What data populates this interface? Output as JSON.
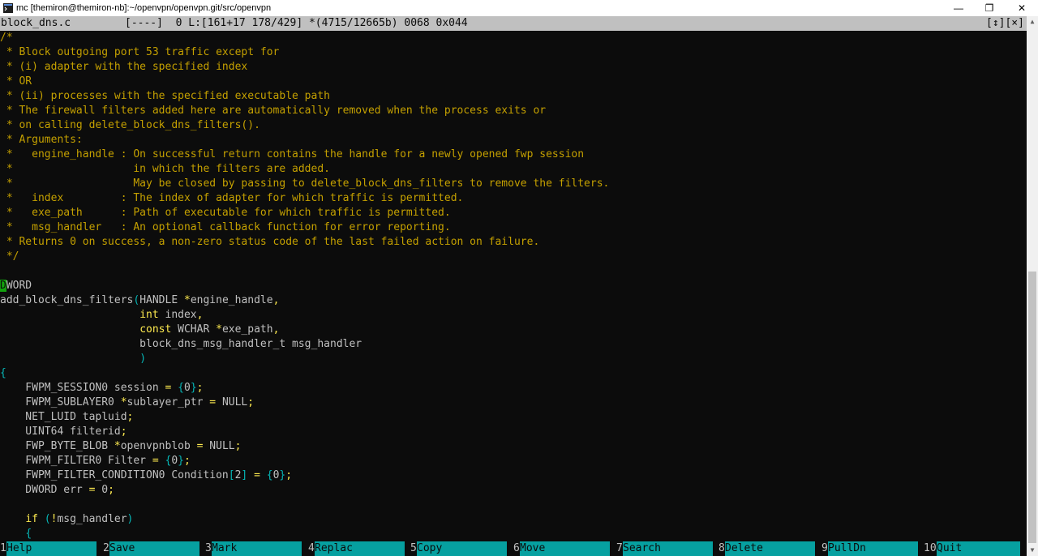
{
  "window": {
    "title": "mc [themiron@themiron-nb]:~/openvpn/openvpn.git/src/openvpn",
    "minimize": "—",
    "maximize": "❐",
    "close": "✕"
  },
  "status": {
    "filename": "block_dns.c",
    "info": "[----]  0 L:[161+17 178/429] *(4715/12665b) 0068 0x044",
    "controls": "[↕][×]"
  },
  "code": [
    [
      [
        "cm",
        "/*"
      ]
    ],
    [
      [
        "cm",
        " * Block outgoing port 53 traffic except for"
      ]
    ],
    [
      [
        "cm",
        " * (i) adapter with the specified index"
      ]
    ],
    [
      [
        "cm",
        " * OR"
      ]
    ],
    [
      [
        "cm",
        " * (ii) processes with the specified executable path"
      ]
    ],
    [
      [
        "cm",
        " * The firewall filters added here are automatically removed when the process exits or"
      ]
    ],
    [
      [
        "cm",
        " * on calling delete_block_dns_filters()."
      ]
    ],
    [
      [
        "cm",
        " * Arguments:"
      ]
    ],
    [
      [
        "cm",
        " *   engine_handle : On successful return contains the handle for a newly opened fwp session"
      ]
    ],
    [
      [
        "cm",
        " *                   in which the filters are added."
      ]
    ],
    [
      [
        "cm",
        " *                   May be closed by passing to delete_block_dns_filters to remove the filters."
      ]
    ],
    [
      [
        "cm",
        " *   index         : The index of adapter for which traffic is permitted."
      ]
    ],
    [
      [
        "cm",
        " *   exe_path      : Path of executable for which traffic is permitted."
      ]
    ],
    [
      [
        "cm",
        " *   msg_handler   : An optional callback function for error reporting."
      ]
    ],
    [
      [
        "cm",
        " * Returns 0 on success, a non-zero status code of the last failed action on failure."
      ]
    ],
    [
      [
        "cm",
        " */"
      ]
    ],
    [],
    [
      [
        "cursor",
        "D"
      ],
      [
        "tx",
        "WORD"
      ]
    ],
    [
      [
        "tx",
        "add_block_dns_filters"
      ],
      [
        "br",
        "("
      ],
      [
        "tx",
        "HANDLE "
      ],
      [
        "kw",
        "*"
      ],
      [
        "tx",
        "engine_handle"
      ],
      [
        "kw",
        ","
      ]
    ],
    [
      [
        "tx",
        "                      "
      ],
      [
        "kw",
        "int"
      ],
      [
        "tx",
        " index"
      ],
      [
        "kw",
        ","
      ]
    ],
    [
      [
        "tx",
        "                      "
      ],
      [
        "kw",
        "const"
      ],
      [
        "tx",
        " WCHAR "
      ],
      [
        "kw",
        "*"
      ],
      [
        "tx",
        "exe_path"
      ],
      [
        "kw",
        ","
      ]
    ],
    [
      [
        "tx",
        "                      block_dns_msg_handler_t msg_handler"
      ]
    ],
    [
      [
        "tx",
        "                      "
      ],
      [
        "br",
        ")"
      ]
    ],
    [
      [
        "br",
        "{"
      ]
    ],
    [
      [
        "tx",
        "    FWPM_SESSION0 session "
      ],
      [
        "kw",
        "="
      ],
      [
        "tx",
        " "
      ],
      [
        "br",
        "{"
      ],
      [
        "tx",
        "0"
      ],
      [
        "br",
        "}"
      ],
      [
        "kw",
        ";"
      ]
    ],
    [
      [
        "tx",
        "    FWPM_SUBLAYER0 "
      ],
      [
        "kw",
        "*"
      ],
      [
        "tx",
        "sublayer_ptr "
      ],
      [
        "kw",
        "="
      ],
      [
        "tx",
        " NULL"
      ],
      [
        "kw",
        ";"
      ]
    ],
    [
      [
        "tx",
        "    NET_LUID tapluid"
      ],
      [
        "kw",
        ";"
      ]
    ],
    [
      [
        "tx",
        "    UINT64 filterid"
      ],
      [
        "kw",
        ";"
      ]
    ],
    [
      [
        "tx",
        "    FWP_BYTE_BLOB "
      ],
      [
        "kw",
        "*"
      ],
      [
        "tx",
        "openvpnblob "
      ],
      [
        "kw",
        "="
      ],
      [
        "tx",
        " NULL"
      ],
      [
        "kw",
        ";"
      ]
    ],
    [
      [
        "tx",
        "    FWPM_FILTER0 Filter "
      ],
      [
        "kw",
        "="
      ],
      [
        "tx",
        " "
      ],
      [
        "br",
        "{"
      ],
      [
        "tx",
        "0"
      ],
      [
        "br",
        "}"
      ],
      [
        "kw",
        ";"
      ]
    ],
    [
      [
        "tx",
        "    FWPM_FILTER_CONDITION0 Condition"
      ],
      [
        "br",
        "["
      ],
      [
        "tx",
        "2"
      ],
      [
        "br",
        "]"
      ],
      [
        "tx",
        " "
      ],
      [
        "kw",
        "="
      ],
      [
        "tx",
        " "
      ],
      [
        "br",
        "{"
      ],
      [
        "tx",
        "0"
      ],
      [
        "br",
        "}"
      ],
      [
        "kw",
        ";"
      ]
    ],
    [
      [
        "tx",
        "    DWORD err "
      ],
      [
        "kw",
        "="
      ],
      [
        "tx",
        " 0"
      ],
      [
        "kw",
        ";"
      ]
    ],
    [],
    [
      [
        "tx",
        "    "
      ],
      [
        "kw",
        "if"
      ],
      [
        "tx",
        " "
      ],
      [
        "br",
        "("
      ],
      [
        "kw",
        "!"
      ],
      [
        "tx",
        "msg_handler"
      ],
      [
        "br",
        ")"
      ]
    ],
    [
      [
        "tx",
        "    "
      ],
      [
        "br",
        "{"
      ]
    ]
  ],
  "fkeys": [
    {
      "num": "1",
      "label": "Help"
    },
    {
      "num": "2",
      "label": "Save"
    },
    {
      "num": "3",
      "label": "Mark"
    },
    {
      "num": "4",
      "label": "Replac"
    },
    {
      "num": "5",
      "label": "Copy"
    },
    {
      "num": "6",
      "label": "Move"
    },
    {
      "num": "7",
      "label": "Search"
    },
    {
      "num": "8",
      "label": "Delete"
    },
    {
      "num": "9",
      "label": "PullDn"
    },
    {
      "num": "10",
      "label": "Quit"
    }
  ],
  "scrollbar": {
    "up_icon": "▲",
    "down_icon": "▼"
  }
}
